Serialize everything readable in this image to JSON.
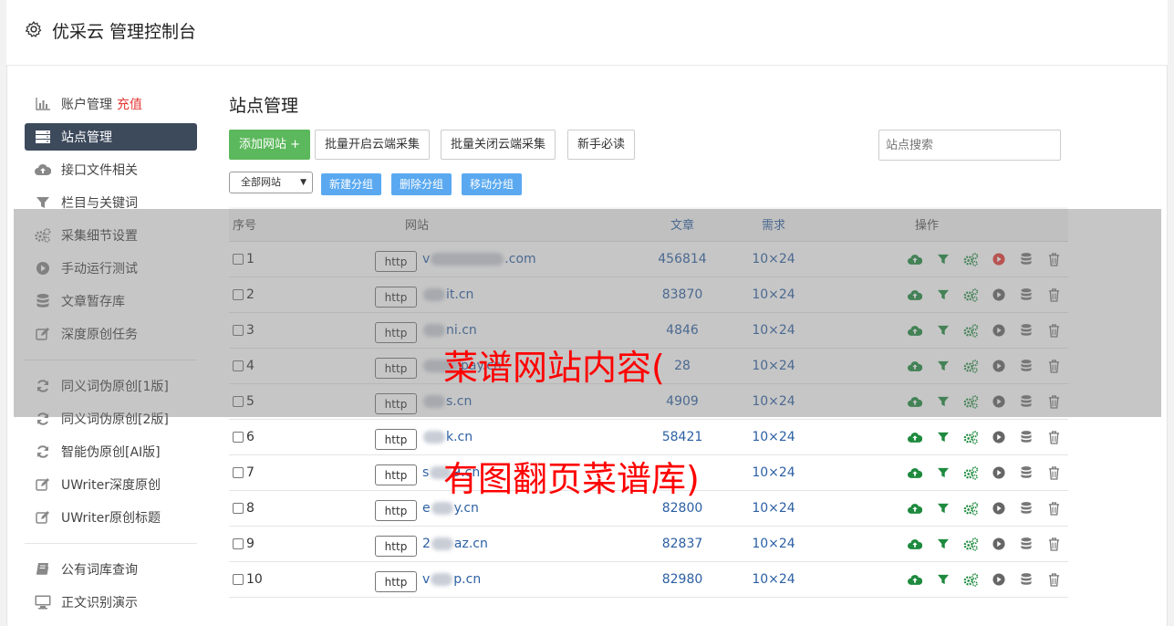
{
  "header": {
    "title": "优采云 管理控制台"
  },
  "sidebar": {
    "items": [
      {
        "label": "账户管理",
        "extra": "充值",
        "icon": "bar-chart-icon"
      },
      {
        "label": "站点管理",
        "icon": "server-icon",
        "active": true
      },
      {
        "label": "接口文件相关",
        "icon": "cloud-upload-icon"
      },
      {
        "label": "栏目与关键词",
        "icon": "filter-icon"
      },
      {
        "label": "采集细节设置",
        "icon": "gears-icon"
      },
      {
        "label": "手动运行测试",
        "icon": "play-circle-icon"
      },
      {
        "label": "文章暂存库",
        "icon": "database-icon"
      },
      {
        "label": "深度原创任务",
        "icon": "edit-icon"
      }
    ],
    "items2": [
      {
        "label": "同义词伪原创[1版]",
        "icon": "refresh-icon"
      },
      {
        "label": "同义词伪原创[2版]",
        "icon": "refresh-icon"
      },
      {
        "label": "智能伪原创[AI版]",
        "icon": "refresh-icon"
      },
      {
        "label": "UWriter深度原创",
        "icon": "edit-icon"
      },
      {
        "label": "UWriter原创标题",
        "icon": "edit-icon"
      }
    ],
    "items3": [
      {
        "label": "公有词库查询",
        "icon": "book-icon"
      },
      {
        "label": "正文识别演示",
        "icon": "monitor-icon"
      }
    ]
  },
  "main": {
    "title": "站点管理",
    "buttons": {
      "add": "添加网站 +",
      "batch_open": "批量开启云端采集",
      "batch_close": "批量关闭云端采集",
      "guide": "新手必读"
    },
    "search_placeholder": "站点搜索",
    "group_select": "全部网站",
    "group_buttons": {
      "new": "新建分组",
      "delete": "删除分组",
      "move": "移动分组"
    },
    "table": {
      "headers": {
        "no": "序号",
        "site": "网站",
        "articles": "文章",
        "demand": "需求",
        "ops": "操作"
      },
      "rows": [
        {
          "no": "1",
          "prefix": "v",
          "suffix": ".com",
          "articles": "456814",
          "demand": "10×24",
          "running": true
        },
        {
          "no": "2",
          "prefix": "",
          "suffix": "it.cn",
          "articles": "83870",
          "demand": "10×24"
        },
        {
          "no": "3",
          "prefix": "",
          "suffix": "ni.cn",
          "articles": "4846",
          "demand": "10×24"
        },
        {
          "no": "4",
          "prefix": "",
          "suffix": "pay.cn",
          "articles": "28",
          "demand": "10×24"
        },
        {
          "no": "5",
          "prefix": "",
          "suffix": "s.cn",
          "articles": "4909",
          "demand": "10×24"
        },
        {
          "no": "6",
          "prefix": "",
          "suffix": "k.cn",
          "articles": "58421",
          "demand": "10×24"
        },
        {
          "no": "7",
          "prefix": "s",
          "suffix": "9.cn",
          "articles": "",
          "demand": "10×24"
        },
        {
          "no": "8",
          "prefix": "e",
          "suffix": "y.cn",
          "articles": "82800",
          "demand": "10×24"
        },
        {
          "no": "9",
          "prefix": "2",
          "suffix": "az.cn",
          "articles": "82837",
          "demand": "10×24"
        },
        {
          "no": "10",
          "prefix": "v",
          "suffix": "p.cn",
          "articles": "82980",
          "demand": "10×24"
        }
      ],
      "http_label": "http"
    }
  },
  "watermark": {
    "line1": "菜谱网站内容(",
    "line2": "有图翻页菜谱库)"
  },
  "colors": {
    "green": "#1e8a3e",
    "blue_link": "#2b5fa3",
    "red": "#e53935",
    "sidebar_active": "#3d4a5c"
  }
}
